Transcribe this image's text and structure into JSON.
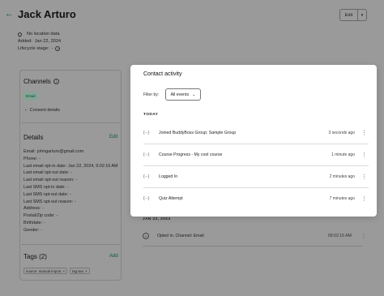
{
  "contact": {
    "back_glyph": "←",
    "name": "Jack Arturo",
    "location": "No location data",
    "added_label": "Added:",
    "added_value": "Jan 22, 2024",
    "lifecycle_label": "Lifecycle stage:",
    "lifecycle_value": "-",
    "edit_label": "Edit",
    "more_glyph": "▾"
  },
  "channels": {
    "title": "Channels",
    "badge": "Email",
    "consent_label": "Consent details"
  },
  "details": {
    "title": "Details",
    "edit_label": "Edit",
    "rows": [
      {
        "label": "Email:",
        "value": "johngarturo@gmail.com"
      },
      {
        "label": "Phone:",
        "value": "-"
      },
      {
        "label": "Last email opt-in date:",
        "value": "Jan 22, 2024, 9:02:16 AM"
      },
      {
        "label": "Last email opt-out date:",
        "value": "-"
      },
      {
        "label": "Last email opt-out reason:",
        "value": "-"
      },
      {
        "label": "Last SMS opt-in date:",
        "value": "-"
      },
      {
        "label": "Last SMS opt-out date:",
        "value": "-"
      },
      {
        "label": "Last SMS opt-out reason:",
        "value": "-"
      },
      {
        "label": "Address:",
        "value": "-"
      },
      {
        "label": "Postal/Zip code:",
        "value": "-"
      },
      {
        "label": "Birthdate:",
        "value": "-"
      },
      {
        "label": "Gender:",
        "value": "-"
      }
    ]
  },
  "tags": {
    "title": "Tags (2)",
    "add_label": "Add",
    "items": [
      "source: manual import",
      "tag two"
    ]
  },
  "background_activity": {
    "date": "JAN 22, 2024",
    "text": "Opted in. Channel: Email",
    "time": "09:02:16 AM"
  },
  "modal": {
    "title": "Contact activity",
    "filter_label": "Filter by:",
    "filter_value": "All events",
    "today_label": "TODAY",
    "items": [
      {
        "text": "Joined BuddyBoss Group: Sample Group",
        "time": "3 seconds ago"
      },
      {
        "text": "Course Progress - My cool course",
        "time": "1 minute ago"
      },
      {
        "text": "Logged In",
        "time": "2 minutes ago"
      },
      {
        "text": "Quiz Attempt",
        "time": "7 minutes ago"
      }
    ]
  },
  "colors": {
    "accent": "#0f5b34",
    "overlay": "#9a9a9a",
    "modal_bg": "#ffffff"
  }
}
